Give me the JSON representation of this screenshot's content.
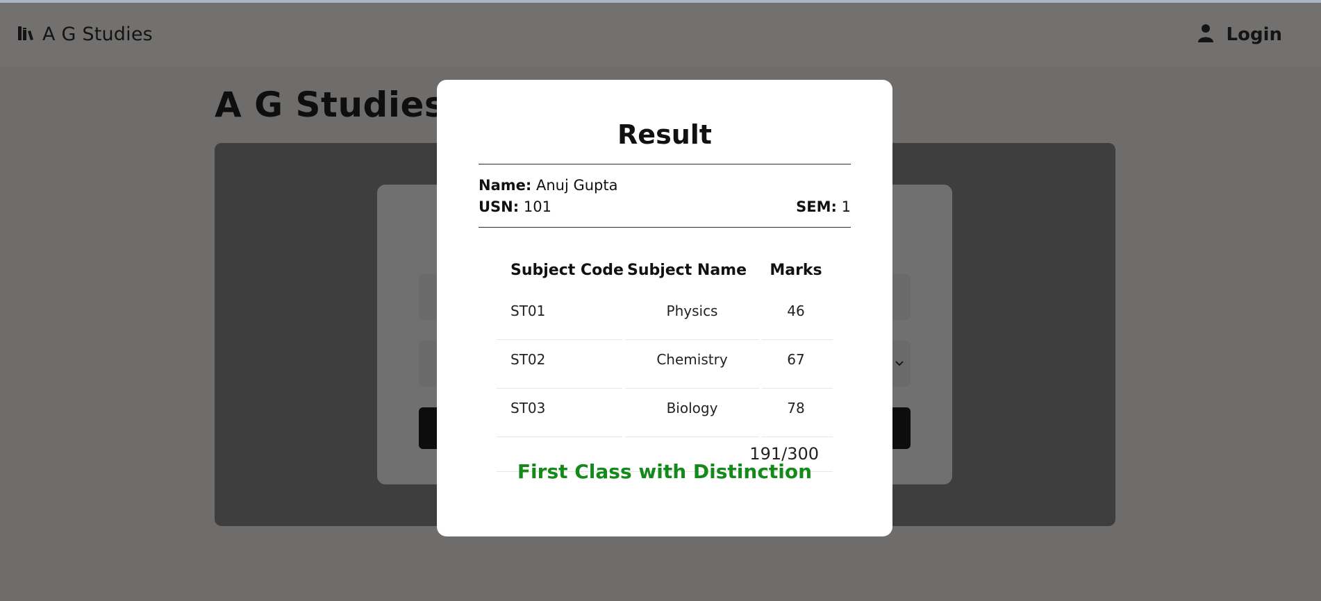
{
  "navbar": {
    "brand": "A G Studies",
    "brand_icon": "books-icon",
    "login_label": "Login",
    "login_icon": "user-icon"
  },
  "page": {
    "title": "A G Studies"
  },
  "modal": {
    "title": "Result",
    "name_label": "Name:",
    "name_value": "Anuj Gupta",
    "usn_label": "USN:",
    "usn_value": "101",
    "sem_label": "SEM:",
    "sem_value": "1",
    "table": {
      "headers": [
        "Subject Code",
        "Subject Name",
        "Marks"
      ],
      "rows": [
        {
          "code": "ST01",
          "name": "Physics",
          "marks": "46"
        },
        {
          "code": "ST02",
          "name": "Chemistry",
          "marks": "67"
        },
        {
          "code": "ST03",
          "name": "Biology",
          "marks": "78"
        }
      ],
      "total": "191/300"
    },
    "verdict": "First Class with Distinction",
    "verdict_color": "#138a1a"
  }
}
